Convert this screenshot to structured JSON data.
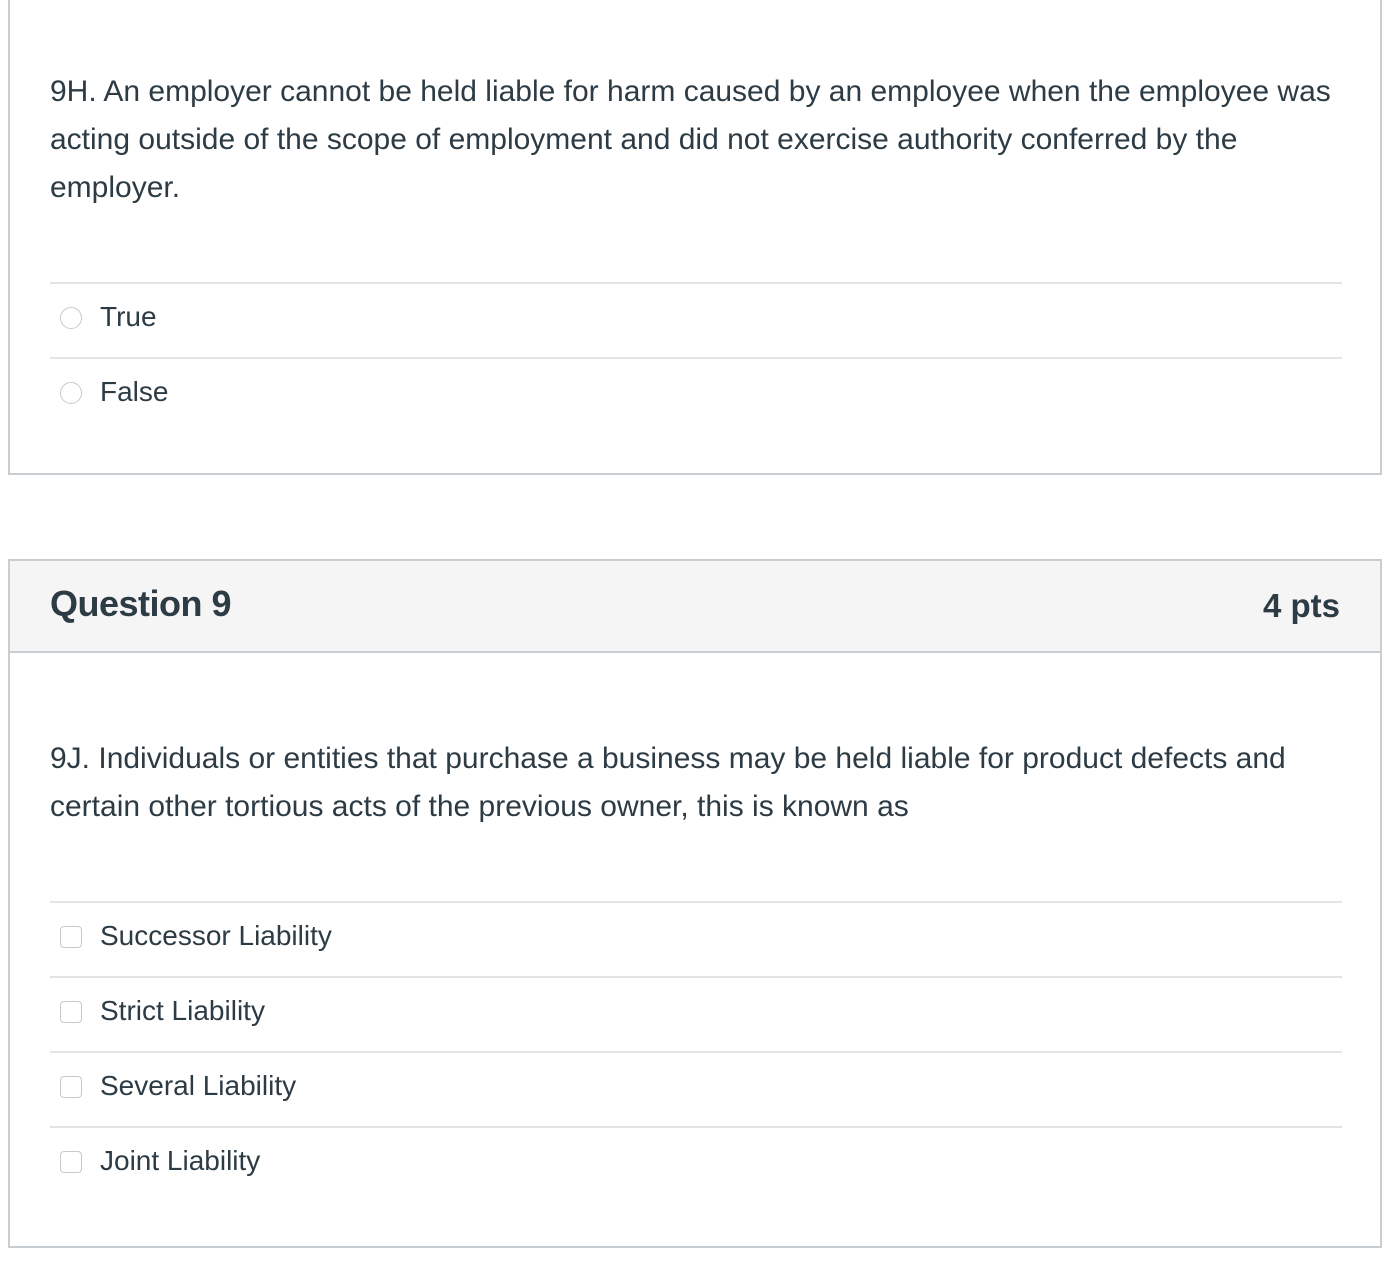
{
  "question_8": {
    "text": "9H.  An employer cannot be held liable for harm caused by an employee when the employee was acting outside of the scope of employment and did not exercise authority conferred by the employer.",
    "answers": [
      {
        "label": "True"
      },
      {
        "label": "False"
      }
    ]
  },
  "question_9": {
    "title": "Question 9",
    "points": "4 pts",
    "text": "9J. Individuals or entities that purchase a business may be held liable for product defects and certain other tortious acts of the previous owner, this is known as",
    "answers": [
      {
        "label": "Successor Liability"
      },
      {
        "label": "Strict Liability"
      },
      {
        "label": "Several Liability"
      },
      {
        "label": "Joint Liability"
      }
    ]
  }
}
